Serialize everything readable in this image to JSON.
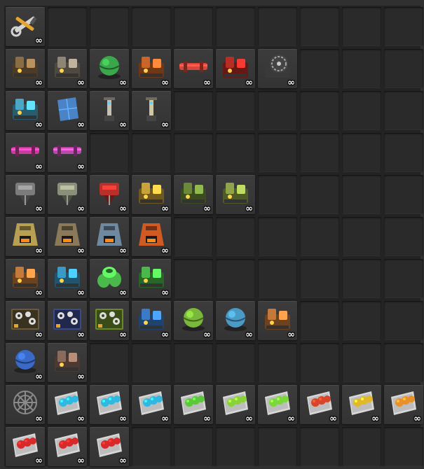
{
  "inventory": {
    "columns": 10,
    "rows": [
      {
        "items": [
          {
            "name": "repair-tools",
            "icon": "wrench-screwdriver-icon",
            "kind": "tools",
            "color": "#d79a2b",
            "count": "∞"
          }
        ]
      },
      {
        "items": [
          {
            "name": "burner-generator",
            "icon": "burner-generator-icon",
            "kind": "machine",
            "color": "#8a6c45",
            "count": "∞"
          },
          {
            "name": "steam-engine",
            "icon": "steam-engine-icon",
            "kind": "machine",
            "color": "#8f8574",
            "count": "∞"
          },
          {
            "name": "fusion-reactor",
            "icon": "reactor-icon",
            "kind": "sphere",
            "color": "#3aa84a",
            "count": "∞"
          },
          {
            "name": "heat-exchanger",
            "icon": "heat-exchanger-icon",
            "kind": "machine",
            "color": "#c8662a",
            "count": "∞"
          },
          {
            "name": "heat-pipe",
            "icon": "heat-pipe-icon",
            "kind": "pipe",
            "color": "#d8453a",
            "count": "∞"
          },
          {
            "name": "boiler",
            "icon": "boiler-icon",
            "kind": "machine",
            "color": "#b82c25",
            "count": "∞"
          },
          {
            "name": "turbine",
            "icon": "turbine-icon",
            "kind": "fan",
            "color": "#7c7c7c",
            "count": "∞"
          }
        ]
      },
      {
        "items": [
          {
            "name": "accumulator",
            "icon": "accumulator-icon",
            "kind": "machine",
            "color": "#4aa8c6",
            "count": "∞"
          },
          {
            "name": "solar-panel",
            "icon": "solar-panel-icon",
            "kind": "panel",
            "color": "#4a84c6",
            "count": "∞"
          },
          {
            "name": "medium-power-pole",
            "icon": "power-pole-icon",
            "kind": "pole",
            "color": "#c4c0b4",
            "count": "∞"
          },
          {
            "name": "big-power-pole",
            "icon": "power-pole-icon",
            "kind": "pole",
            "color": "#d0c7a3",
            "count": "∞"
          }
        ]
      },
      {
        "items": [
          {
            "name": "pink-pipe",
            "icon": "pipe-icon",
            "kind": "pipe",
            "color": "#c43e9a",
            "count": "∞"
          },
          {
            "name": "pink-pipe-to-ground",
            "icon": "pipe-to-ground-icon",
            "kind": "pipe",
            "color": "#b84aa8",
            "count": "∞"
          }
        ]
      },
      {
        "items": [
          {
            "name": "burner-mining-drill",
            "icon": "mining-drill-icon",
            "kind": "drill",
            "color": "#7c7c7c",
            "count": "∞"
          },
          {
            "name": "electric-mining-drill",
            "icon": "mining-drill-icon",
            "kind": "drill",
            "color": "#8a8f7a",
            "count": "∞"
          },
          {
            "name": "big-mining-drill",
            "icon": "mining-drill-icon",
            "kind": "drill",
            "color": "#b8302a",
            "count": "∞"
          },
          {
            "name": "offshore-pump",
            "icon": "pump-icon",
            "kind": "machine",
            "color": "#c9a23a",
            "count": "∞"
          },
          {
            "name": "pumpjack",
            "icon": "pumpjack-icon",
            "kind": "machine",
            "color": "#6a8a3a",
            "count": "∞"
          },
          {
            "name": "water-well",
            "icon": "pump-icon",
            "kind": "machine",
            "color": "#8fa34a",
            "count": "∞"
          }
        ]
      },
      {
        "items": [
          {
            "name": "stone-furnace",
            "icon": "furnace-icon",
            "kind": "furnace",
            "color": "#b8a052",
            "count": "∞"
          },
          {
            "name": "steel-furnace",
            "icon": "furnace-icon",
            "kind": "furnace",
            "color": "#8a7a5a",
            "count": "∞"
          },
          {
            "name": "electric-furnace",
            "icon": "furnace-icon",
            "kind": "furnace",
            "color": "#6f8aa0",
            "count": "∞"
          },
          {
            "name": "foundry",
            "icon": "foundry-icon",
            "kind": "furnace",
            "color": "#d05a22",
            "count": "∞"
          }
        ]
      },
      {
        "items": [
          {
            "name": "oil-refinery",
            "icon": "refinery-icon",
            "kind": "machine",
            "color": "#c47a3a",
            "count": "∞"
          },
          {
            "name": "chemical-plant",
            "icon": "chemical-plant-icon",
            "kind": "machine",
            "color": "#3a9ac6",
            "count": "∞"
          },
          {
            "name": "storage-tanks",
            "icon": "tank-icon",
            "kind": "tanks",
            "color": "#4ab84a",
            "count": "∞"
          },
          {
            "name": "electromagnetic-plant",
            "icon": "plant-icon",
            "kind": "machine",
            "color": "#4ab84a",
            "count": "∞"
          }
        ]
      },
      {
        "items": [
          {
            "name": "assembling-machine-1",
            "icon": "gears-icon",
            "kind": "assembler",
            "color": "#6a5a3a",
            "count": "∞"
          },
          {
            "name": "assembling-machine-2",
            "icon": "gears-icon",
            "kind": "assembler",
            "color": "#3a4a8a",
            "count": "∞"
          },
          {
            "name": "assembling-machine-3",
            "icon": "gears-icon",
            "kind": "assembler",
            "color": "#6a8a2a",
            "count": "∞"
          },
          {
            "name": "lab",
            "icon": "lab-icon",
            "kind": "machine",
            "color": "#3a7ac6",
            "count": "∞"
          },
          {
            "name": "biochamber",
            "icon": "biochamber-icon",
            "kind": "sphere",
            "color": "#7ab83a",
            "count": "∞"
          },
          {
            "name": "cryogenic-plant",
            "icon": "cryo-icon",
            "kind": "sphere",
            "color": "#4a9ac6",
            "count": "∞"
          },
          {
            "name": "recycler",
            "icon": "recycler-icon",
            "kind": "machine",
            "color": "#c4783a",
            "count": "∞"
          }
        ]
      },
      {
        "items": [
          {
            "name": "shield-dome",
            "icon": "dome-icon",
            "kind": "sphere",
            "color": "#3a6ac8",
            "count": "∞"
          },
          {
            "name": "spidertron",
            "icon": "spider-icon",
            "kind": "machine",
            "color": "#8a6a5a",
            "count": "∞"
          }
        ]
      },
      {
        "items": [
          {
            "name": "radar",
            "icon": "radar-icon",
            "kind": "web",
            "color": "#8a8a8a",
            "count": "∞"
          },
          {
            "name": "module-cyan-1",
            "icon": "module-icon",
            "kind": "module",
            "color": "#2fb8e0",
            "count": "∞"
          },
          {
            "name": "module-cyan-2",
            "icon": "module-icon",
            "kind": "module",
            "color": "#2fb8e0",
            "count": "∞"
          },
          {
            "name": "module-cyan-3",
            "icon": "module-icon",
            "kind": "module",
            "color": "#2fb8e0",
            "count": "∞"
          },
          {
            "name": "module-green-1",
            "icon": "module-icon",
            "kind": "module",
            "color": "#5ac83a",
            "count": "∞"
          },
          {
            "name": "module-green-2",
            "icon": "module-icon",
            "kind": "module",
            "color": "#8ad23a",
            "count": "∞"
          },
          {
            "name": "module-green-3",
            "icon": "module-icon",
            "kind": "module",
            "color": "#7ad83a",
            "count": "∞"
          },
          {
            "name": "module-red-1",
            "icon": "module-icon",
            "kind": "module",
            "color": "#d8452a",
            "count": "∞"
          },
          {
            "name": "module-yellow-2",
            "icon": "module-icon",
            "kind": "module",
            "color": "#e0b82a",
            "count": "∞"
          },
          {
            "name": "module-orange-3",
            "icon": "module-icon",
            "kind": "module",
            "color": "#e8902a",
            "count": "∞"
          }
        ]
      },
      {
        "items": [
          {
            "name": "module-red-a",
            "icon": "module-icon",
            "kind": "module",
            "color": "#d82a2a",
            "count": "∞"
          },
          {
            "name": "module-red-b",
            "icon": "module-icon",
            "kind": "module",
            "color": "#d82a2a",
            "count": "∞"
          },
          {
            "name": "module-red-c",
            "icon": "module-icon",
            "kind": "module",
            "color": "#d82a2a",
            "count": "∞"
          }
        ]
      }
    ]
  }
}
